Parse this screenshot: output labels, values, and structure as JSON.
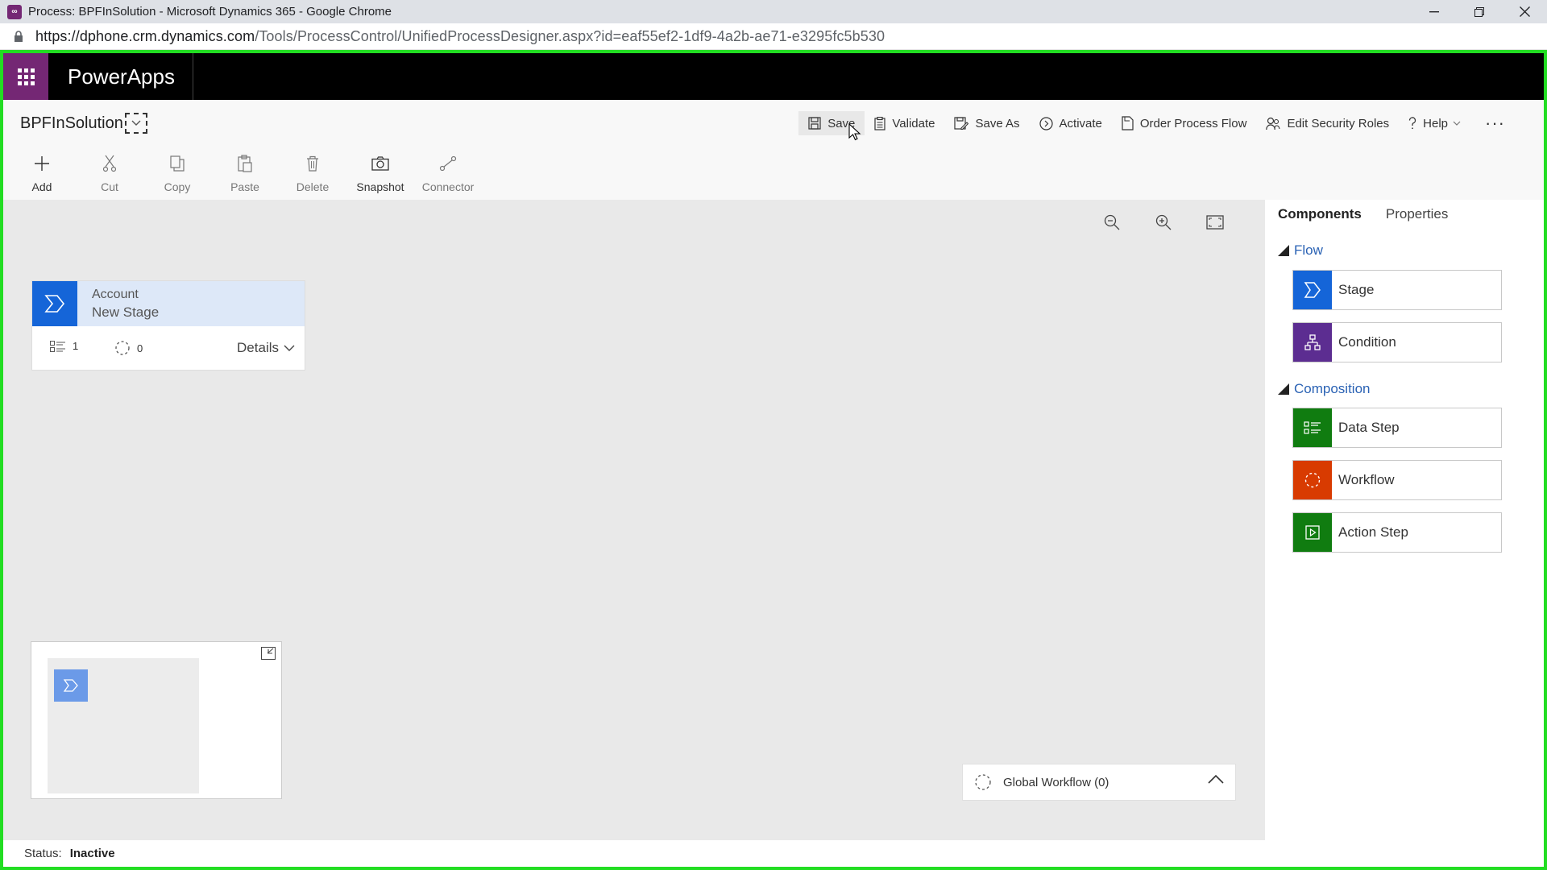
{
  "browser": {
    "title": "Process: BPFInSolution - Microsoft Dynamics 365 - Google Chrome",
    "url_host": "https://dphone.crm.dynamics.com",
    "url_path": "/Tools/ProcessControl/UnifiedProcessDesigner.aspx?id=eaf55ef2-1df9-4a2b-ae71-e3295fc5b530"
  },
  "app": {
    "brand": "PowerApps"
  },
  "process": {
    "name": "BPFInSolution"
  },
  "commands": {
    "save": "Save",
    "validate": "Validate",
    "save_as": "Save As",
    "activate": "Activate",
    "order_process_flow": "Order Process Flow",
    "edit_security_roles": "Edit Security Roles",
    "help": "Help",
    "more": "···"
  },
  "ribbon": {
    "add": "Add",
    "cut": "Cut",
    "copy": "Copy",
    "paste": "Paste",
    "delete": "Delete",
    "snapshot": "Snapshot",
    "connector": "Connector"
  },
  "stage_card": {
    "entity": "Account",
    "name": "New Stage",
    "data_steps_count": "1",
    "workflows_count": "0",
    "details_label": "Details"
  },
  "global_workflow": {
    "label": "Global Workflow (0)"
  },
  "status": {
    "label": "Status:",
    "value": "Inactive"
  },
  "panel": {
    "tabs": [
      "Components",
      "Properties"
    ],
    "flow_section": "Flow",
    "composition_section": "Composition",
    "components": {
      "stage": "Stage",
      "condition": "Condition",
      "data_step": "Data Step",
      "workflow": "Workflow",
      "action_step": "Action Step"
    }
  },
  "colors": {
    "brand_purple": "#742774",
    "stage_blue": "#1565d8",
    "condition_purple": "#5c2d91",
    "data_step_green": "#107c10",
    "workflow_orange": "#d83b01",
    "action_step_green": "#107c10",
    "frame_green": "#22dd22"
  }
}
